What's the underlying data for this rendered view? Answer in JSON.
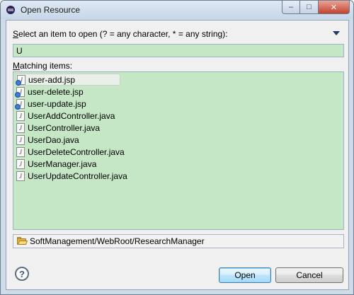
{
  "window": {
    "title": "Open Resource",
    "app_icon": "eclipse-icon",
    "controls": {
      "minimize": "–",
      "maximize": "□",
      "close": "✕"
    }
  },
  "prompt": {
    "label_accel": "S",
    "label_rest": "elect an item to open (? = any character, * = any string):",
    "menu_icon": "chevron-down-icon"
  },
  "search": {
    "value": "U"
  },
  "matching": {
    "label_accel": "M",
    "label_rest": "atching items:",
    "items": [
      {
        "label": "user-add.jsp",
        "icon": "jsp-file-icon",
        "icon_glyph": "J",
        "selected": true
      },
      {
        "label": "user-delete.jsp",
        "icon": "jsp-file-icon",
        "icon_glyph": "J",
        "selected": false
      },
      {
        "label": "user-update.jsp",
        "icon": "jsp-file-icon",
        "icon_glyph": "J",
        "selected": false
      },
      {
        "label": "UserAddController.java",
        "icon": "java-file-icon",
        "icon_glyph": "J",
        "selected": false
      },
      {
        "label": "UserController.java",
        "icon": "java-file-icon",
        "icon_glyph": "J",
        "selected": false
      },
      {
        "label": "UserDao.java",
        "icon": "java-file-icon",
        "icon_glyph": "J",
        "selected": false
      },
      {
        "label": "UserDeleteController.java",
        "icon": "java-file-icon",
        "icon_glyph": "J",
        "selected": false
      },
      {
        "label": "UserManager.java",
        "icon": "java-file-icon",
        "icon_glyph": "J",
        "selected": false
      },
      {
        "label": "UserUpdateController.java",
        "icon": "java-file-icon",
        "icon_glyph": "J",
        "selected": false
      }
    ]
  },
  "path": {
    "value": "SoftManagement/WebRoot/ResearchManager",
    "icon": "folder-icon"
  },
  "buttons": {
    "help": "?",
    "open": "Open",
    "cancel": "Cancel"
  },
  "colors": {
    "list_background": "#c6e7c6",
    "open_button_border": "#3c7fb1"
  }
}
